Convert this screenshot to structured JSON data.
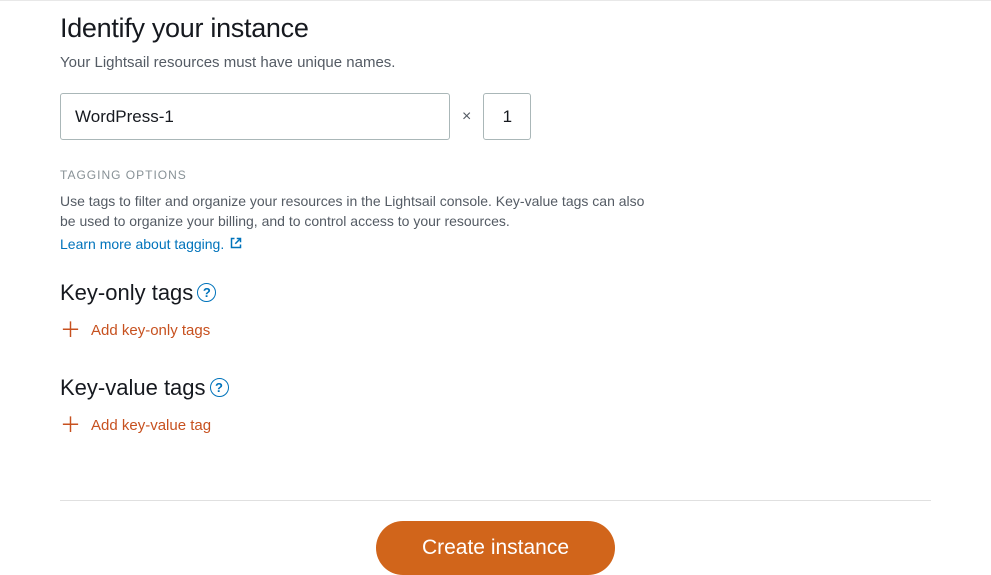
{
  "header": {
    "title": "Identify your instance",
    "subtitle": "Your Lightsail resources must have unique names."
  },
  "instance": {
    "name_value": "WordPress-1",
    "multiply_symbol": "×",
    "count_value": "1"
  },
  "tagging": {
    "section_label": "TAGGING OPTIONS",
    "description": "Use tags to filter and organize your resources in the Lightsail console. Key-value tags can also be used to organize your billing, and to control access to your resources.",
    "learn_more_text": "Learn more about tagging."
  },
  "key_only": {
    "heading": "Key-only tags",
    "help_symbol": "?",
    "add_label": "Add key-only tags"
  },
  "key_value": {
    "heading": "Key-value tags",
    "help_symbol": "?",
    "add_label": "Add key-value tag"
  },
  "actions": {
    "create_label": "Create instance"
  }
}
